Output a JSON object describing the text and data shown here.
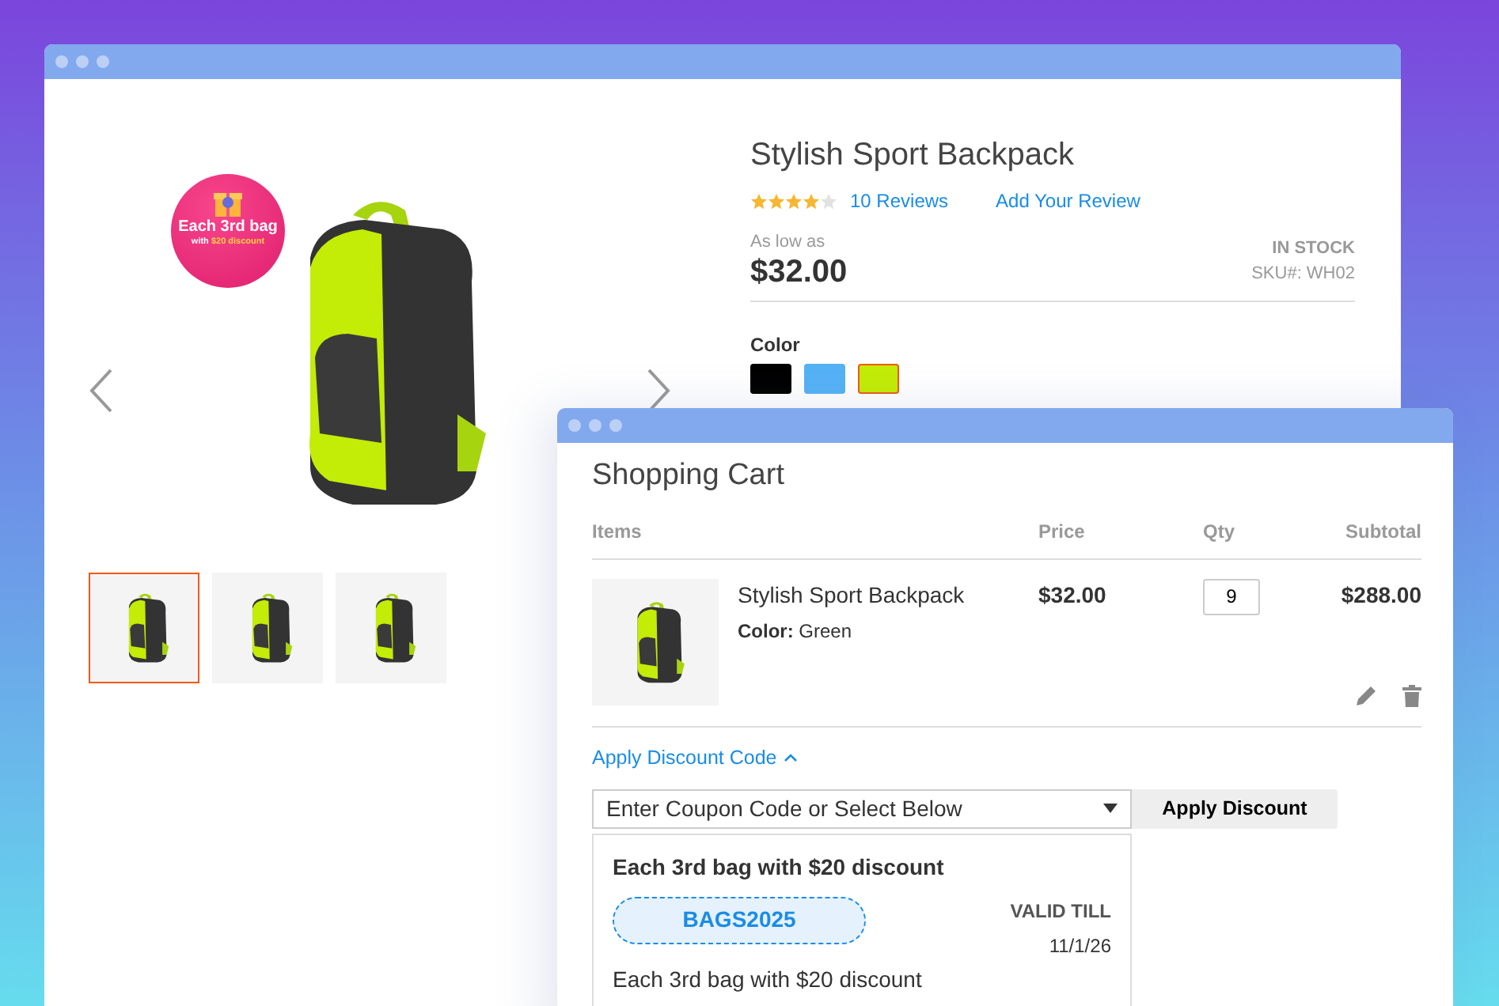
{
  "product_window": {
    "promo_badge": {
      "line_1": "Each 3rd bag",
      "line_2_prefix": "with",
      "line_2_highlight": "$20 discount"
    },
    "thumbnails": [
      {
        "selected": true
      },
      {
        "selected": false
      },
      {
        "selected": false
      }
    ],
    "title": "Stylish Sport Backpack",
    "stars": 4,
    "reviews_link": "10 Reviews",
    "add_review_link": "Add Your Review",
    "price_label": "As low as",
    "price": "$32.00",
    "stock": "IN STOCK",
    "sku": "SKU#: WH02",
    "color_label": "Color",
    "swatches": [
      {
        "color": "#000000",
        "selected": false
      },
      {
        "color": "#55b2f5",
        "selected": false
      },
      {
        "color": "#c3ec06",
        "selected": true
      }
    ]
  },
  "cart_window": {
    "title": "Shopping Cart",
    "columns": [
      "Items",
      "Price",
      "Qty",
      "Subtotal"
    ],
    "rows": [
      {
        "name": "Stylish Sport Backpack",
        "color_label": "Color:",
        "color_value": "Green",
        "price": "$32.00",
        "qty": "9",
        "subtotal": "$288.00"
      }
    ],
    "discount_toggle": {
      "label": "Apply Discount Code",
      "expanded": true
    },
    "coupon_select": {
      "placeholder": "Enter Coupon Code or Select Below"
    },
    "apply_button": "Apply Discount",
    "coupons": [
      {
        "title": "Each 3rd bag with $20 discount",
        "code": "BAGS2025",
        "valid_label": "VALID TILL",
        "valid_date": "11/1/26",
        "description": "Each 3rd bag with $20 discount"
      }
    ]
  }
}
